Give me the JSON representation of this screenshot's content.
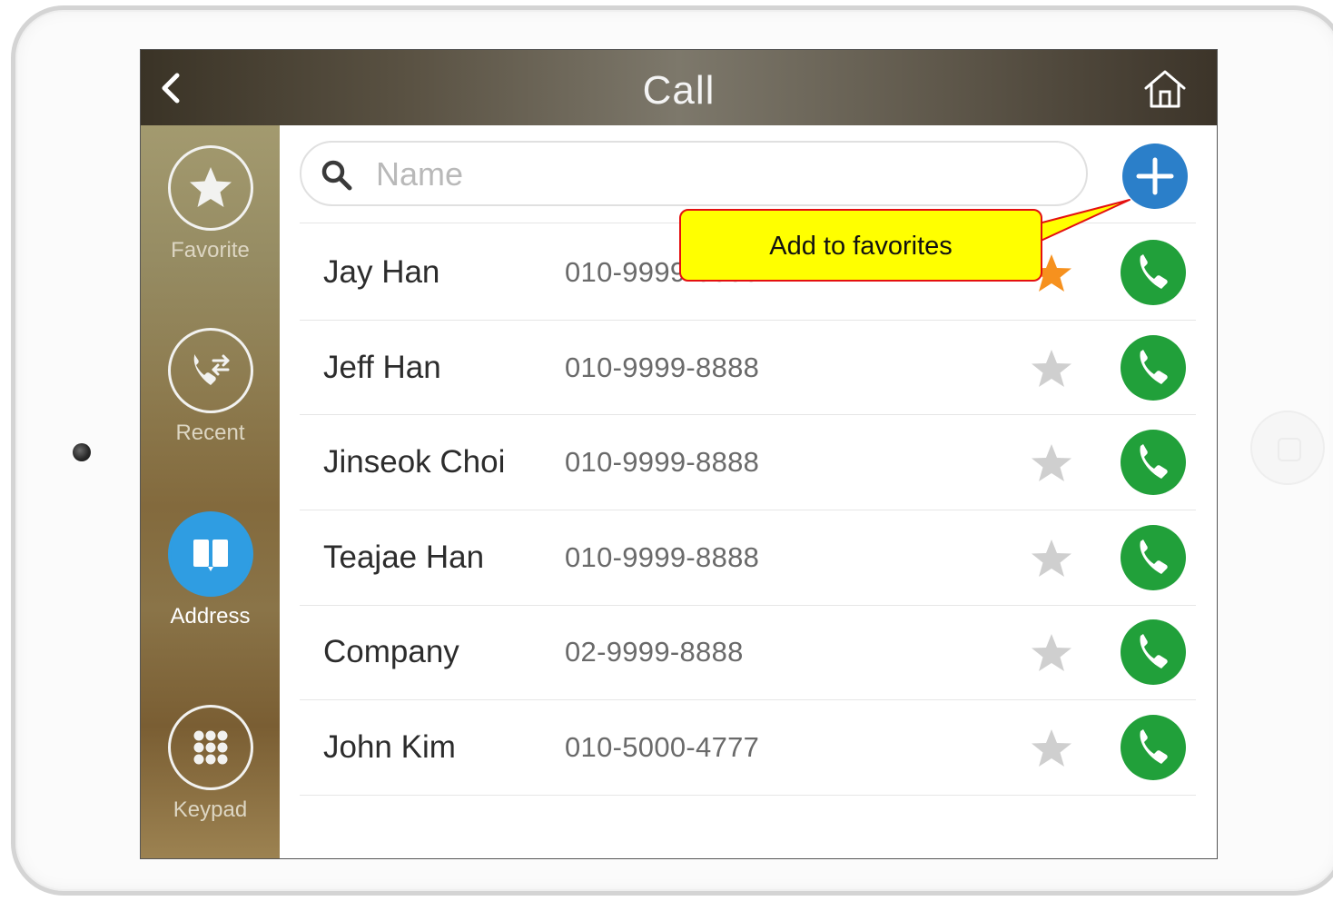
{
  "header": {
    "title": "Call"
  },
  "sidebar": {
    "items": [
      {
        "label": "Favorite",
        "icon": "star-icon",
        "active": false
      },
      {
        "label": "Recent",
        "icon": "call-log-icon",
        "active": false
      },
      {
        "label": "Address",
        "icon": "book-icon",
        "active": true
      },
      {
        "label": "Keypad",
        "icon": "keypad-icon",
        "active": false
      }
    ]
  },
  "search": {
    "placeholder": "Name",
    "value": ""
  },
  "contacts": [
    {
      "name": "Jay Han",
      "phone": "010-9999-8888",
      "favorite": true
    },
    {
      "name": "Jeff Han",
      "phone": "010-9999-8888",
      "favorite": false
    },
    {
      "name": "Jinseok Choi",
      "phone": "010-9999-8888",
      "favorite": false
    },
    {
      "name": "Teajae Han",
      "phone": "010-9999-8888",
      "favorite": false
    },
    {
      "name": "Company",
      "phone": "02-9999-8888",
      "favorite": false
    },
    {
      "name": "John Kim",
      "phone": "010-5000-4777",
      "favorite": false
    }
  ],
  "callout": {
    "text": "Add to favorites"
  },
  "colors": {
    "accent_blue": "#2f9de2",
    "add_button": "#2b7fc9",
    "call_green": "#21a03a",
    "star_active": "#f6911e",
    "star_inactive": "#cfcfcf",
    "callout_fill": "#ffff00",
    "callout_border": "#e41010"
  }
}
